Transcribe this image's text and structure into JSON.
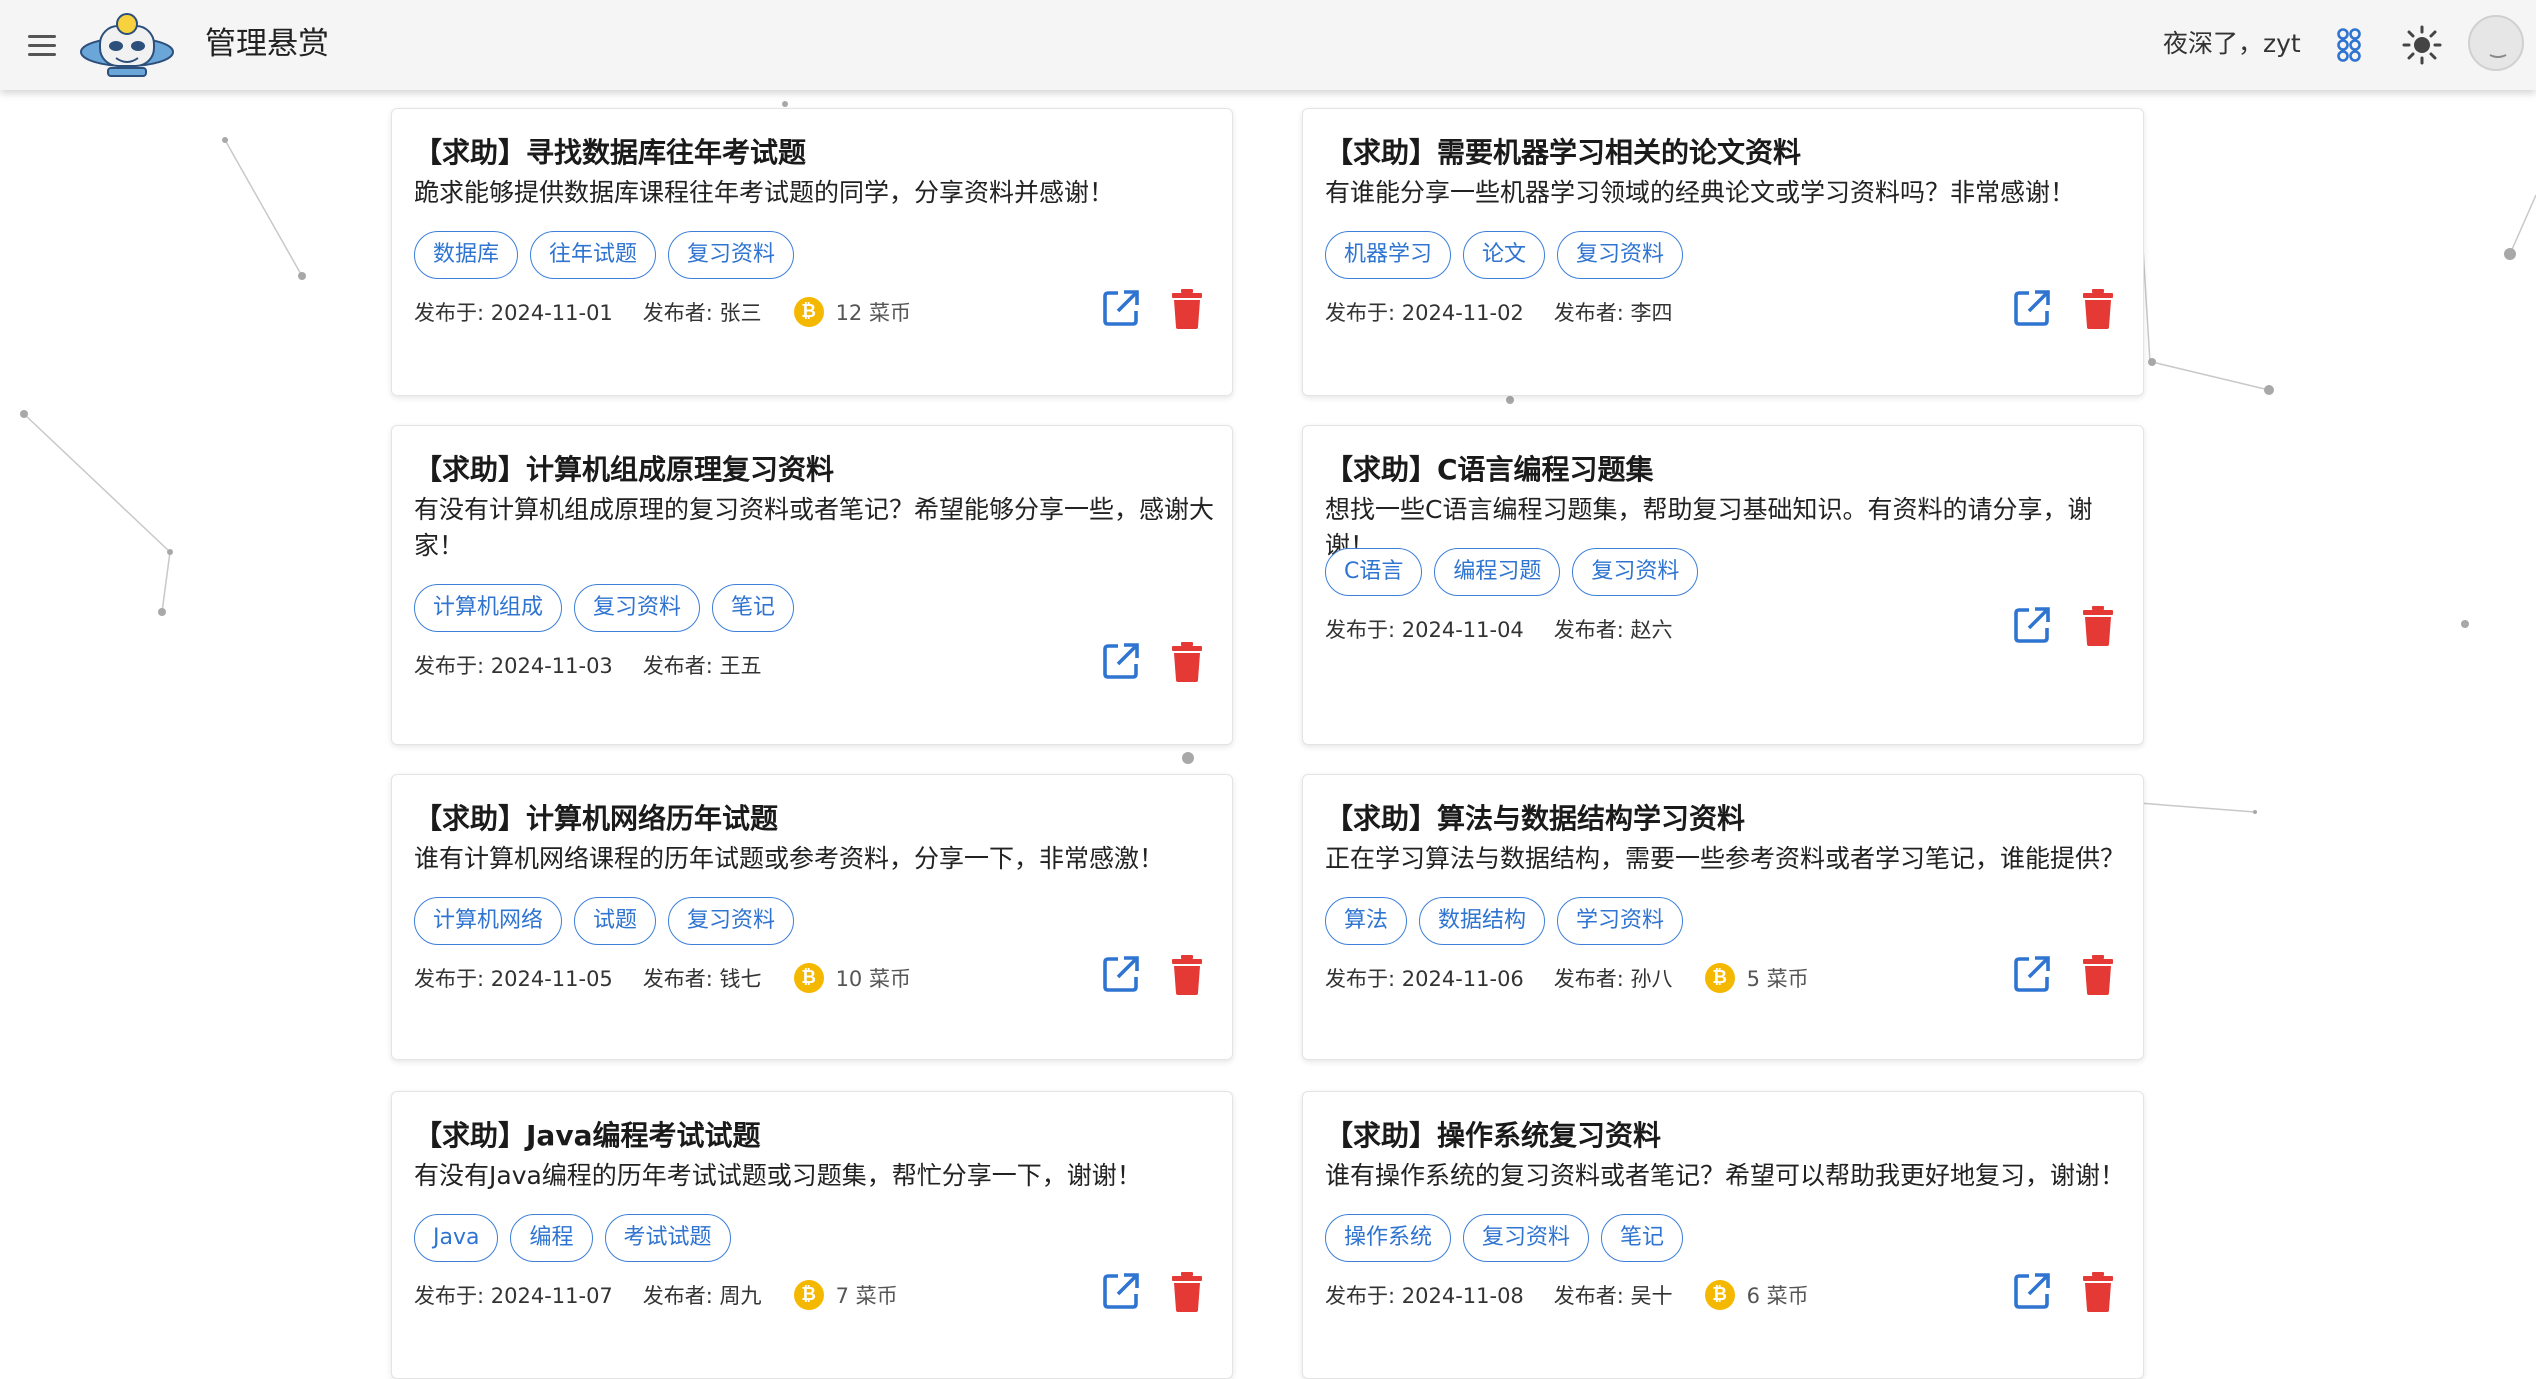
{
  "app": {
    "title": "管理悬赏",
    "greeting": "夜深了，zyt"
  },
  "colors": {
    "accent": "#2f74d0",
    "delete": "#e53935",
    "coin": "#f5b800",
    "appbar": "#f5f5f5"
  },
  "icons": {
    "menu": "menu-icon",
    "theme": "sun-icon",
    "extra": "cluster-icon",
    "edit": "open-in-new-icon",
    "delete": "trash-icon",
    "coin": "bitcoin-icon"
  },
  "labels": {
    "date_prefix": "发布于: ",
    "author_prefix": "发布者: ",
    "coin_unit": "菜币"
  },
  "cards": [
    {
      "title": "【求助】寻找数据库往年考试题",
      "desc": "跪求能够提供数据库课程往年考试题的同学，分享资料并感谢！",
      "tags": [
        "数据库",
        "往年试题",
        "复习资料"
      ],
      "date": "发布于: 2024-11-01",
      "author": "发布者: 张三",
      "reward": "12 菜币"
    },
    {
      "title": "【求助】需要机器学习相关的论文资料",
      "desc": "有谁能分享一些机器学习领域的经典论文或学习资料吗？非常感谢！",
      "tags": [
        "机器学习",
        "论文",
        "复习资料"
      ],
      "date": "发布于: 2024-11-02",
      "author": "发布者: 李四",
      "reward": ""
    },
    {
      "title": "【求助】计算机组成原理复习资料",
      "desc": "有没有计算机组成原理的复习资料或者笔记？希望能够分享一些，感谢大家！",
      "tags": [
        "计算机组成",
        "复习资料",
        "笔记"
      ],
      "date": "发布于: 2024-11-03",
      "author": "发布者: 王五",
      "reward": ""
    },
    {
      "title": "【求助】C语言编程习题集",
      "desc": "想找一些C语言编程习题集，帮助复习基础知识。有资料的请分享，谢谢！",
      "tags": [
        "C语言",
        "编程习题",
        "复习资料"
      ],
      "date": "发布于: 2024-11-04",
      "author": "发布者: 赵六",
      "reward": ""
    },
    {
      "title": "【求助】计算机网络历年试题",
      "desc": "谁有计算机网络课程的历年试题或参考资料，分享一下，非常感激！",
      "tags": [
        "计算机网络",
        "试题",
        "复习资料"
      ],
      "date": "发布于: 2024-11-05",
      "author": "发布者: 钱七",
      "reward": "10 菜币"
    },
    {
      "title": "【求助】算法与数据结构学习资料",
      "desc": "正在学习算法与数据结构，需要一些参考资料或者学习笔记，谁能提供？",
      "tags": [
        "算法",
        "数据结构",
        "学习资料"
      ],
      "date": "发布于: 2024-11-06",
      "author": "发布者: 孙八",
      "reward": "5 菜币"
    },
    {
      "title": "【求助】Java编程考试试题",
      "desc": "有没有Java编程的历年考试试题或习题集，帮忙分享一下，谢谢！",
      "tags": [
        "Java",
        "编程",
        "考试试题"
      ],
      "date": "发布于: 2024-11-07",
      "author": "发布者: 周九",
      "reward": "7 菜币"
    },
    {
      "title": "【求助】操作系统复习资料",
      "desc": "谁有操作系统的复习资料或者笔记？希望可以帮助我更好地复习，谢谢！",
      "tags": [
        "操作系统",
        "复习资料",
        "笔记"
      ],
      "date": "发布于: 2024-11-08",
      "author": "发布者: 吴十",
      "reward": "6 菜币"
    }
  ]
}
